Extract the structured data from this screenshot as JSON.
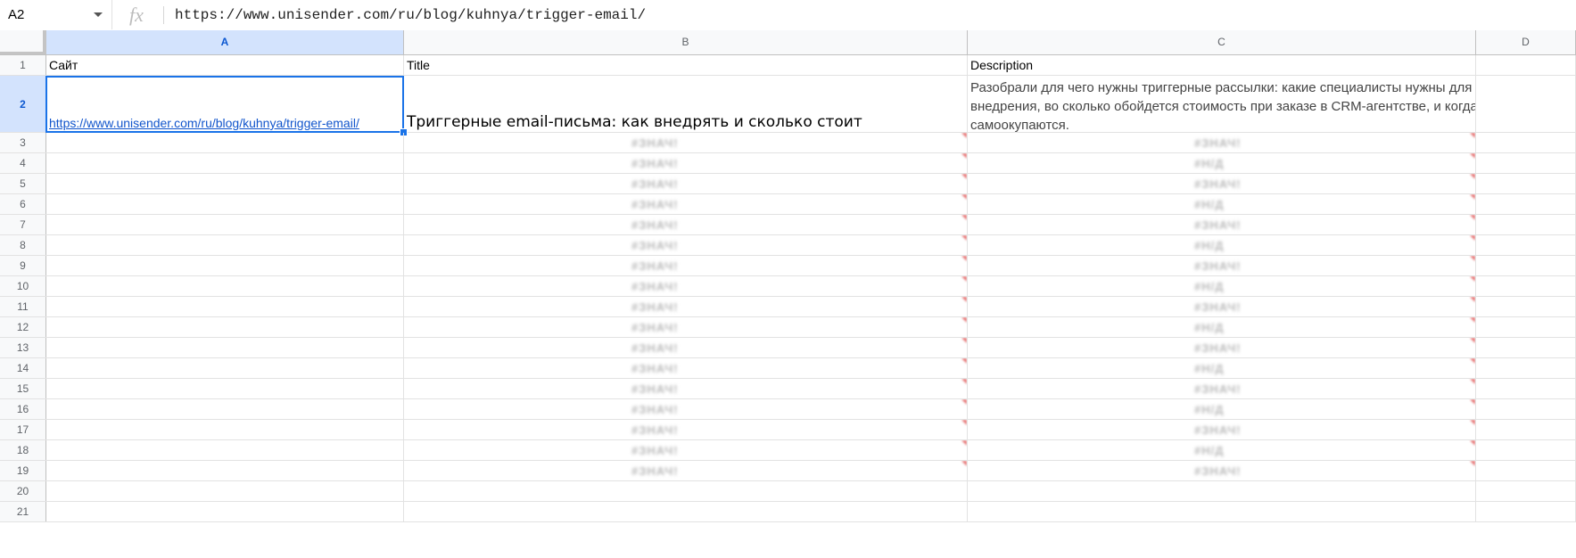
{
  "formula_bar": {
    "name_box": "A2",
    "fx_label": "fx",
    "formula_value": "https://www.unisender.com/ru/blog/kuhnya/trigger-email/"
  },
  "columns": [
    "A",
    "B",
    "C",
    "D"
  ],
  "rows": [
    "1",
    "2",
    "3",
    "4",
    "5",
    "6",
    "7",
    "8",
    "9",
    "10",
    "11",
    "12",
    "13",
    "14",
    "15",
    "16",
    "17",
    "18",
    "19",
    "20",
    "21"
  ],
  "cells": {
    "A1": "Сайт",
    "B1": "Title",
    "C1": "Description",
    "A2": "https://www.unisender.com/ru/blog/kuhnya/trigger-email/",
    "B2": "Триггерные email-письма: как внедрять и сколько стоит",
    "C2": "Разобрали для чего нужны триггерные рассылки: какие специалисты нужны для их внедрения, во сколько обойдется стоимость при заказе в CRM-агентстве, и когда они самоокупаются."
  },
  "blurred_values": {
    "b_col": [
      "#ЗНАЧ!",
      "#ЗНАЧ!",
      "#ЗНАЧ!",
      "#ЗНАЧ!",
      "#ЗНАЧ!",
      "#ЗНАЧ!",
      "#ЗНАЧ!",
      "#ЗНАЧ!",
      "#ЗНАЧ!",
      "#ЗНАЧ!",
      "#ЗНАЧ!",
      "#ЗНАЧ!",
      "#ЗНАЧ!",
      "#ЗНАЧ!",
      "#ЗНАЧ!",
      "#ЗНАЧ!",
      "#ЗНАЧ!"
    ],
    "c_col": [
      "#ЗНАЧ!",
      "#Н/Д",
      "#ЗНАЧ!",
      "#Н/Д",
      "#ЗНАЧ!",
      "#Н/Д",
      "#ЗНАЧ!",
      "#Н/Д",
      "#ЗНАЧ!",
      "#Н/Д",
      "#ЗНАЧ!",
      "#Н/Д",
      "#ЗНАЧ!",
      "#Н/Д",
      "#ЗНАЧ!",
      "#Н/Д",
      "#ЗНАЧ!"
    ]
  },
  "colors": {
    "selection": "#1a73e8",
    "link": "#1155cc",
    "header_bg": "#f8f9fa",
    "gridline": "#e2e2e2",
    "error_marker": "#e57373"
  }
}
